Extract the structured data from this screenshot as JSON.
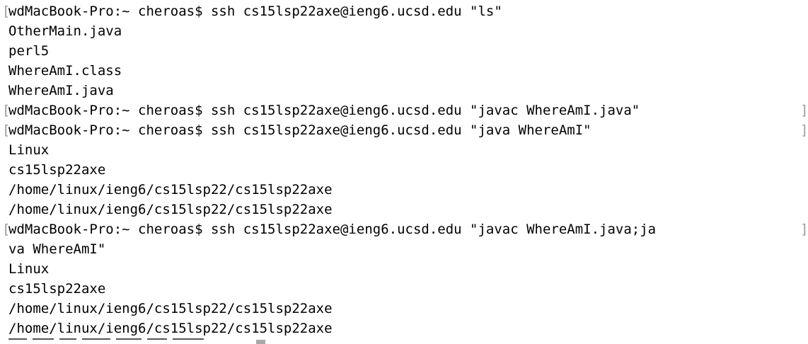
{
  "terminal": {
    "lines": [
      "wdMacBook-Pro:~ cheroas$ ssh cs15lsp22axe@ieng6.ucsd.edu \"ls\"",
      "OtherMain.java",
      "perl5",
      "WhereAmI.class",
      "WhereAmI.java",
      "wdMacBook-Pro:~ cheroas$ ssh cs15lsp22axe@ieng6.ucsd.edu \"javac WhereAmI.java\"",
      "wdMacBook-Pro:~ cheroas$ ssh cs15lsp22axe@ieng6.ucsd.edu \"java WhereAmI\"",
      "Linux",
      "cs15lsp22axe",
      "/home/linux/ieng6/cs15lsp22/cs15lsp22axe",
      "/home/linux/ieng6/cs15lsp22/cs15lsp22axe",
      "wdMacBook-Pro:~ cheroas$ ssh cs15lsp22axe@ieng6.ucsd.edu \"javac WhereAmI.java;ja",
      "va WhereAmI\"",
      "Linux",
      "cs15lsp22axe",
      "/home/linux/ieng6/cs15lsp22/cs15lsp22axe",
      "/home/linux/ieng6/cs15lsp22/cs15lsp22axe"
    ],
    "left_bracket": "[",
    "right_bracket": "]"
  }
}
